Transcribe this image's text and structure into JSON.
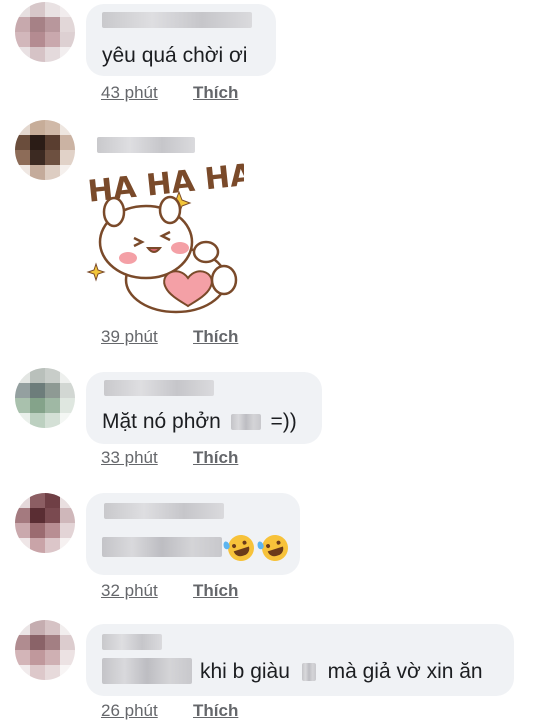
{
  "comments": [
    {
      "text": "yêu quá chời ơi",
      "time": "43 phút",
      "like": "Thích"
    },
    {
      "sticker_text": "HA HA HA",
      "time": "39 phút",
      "like": "Thích"
    },
    {
      "text_before": "Mặt nó phởn",
      "text_after": "=))",
      "time": "33 phút",
      "like": "Thích"
    },
    {
      "emoji": "rolling-on-floor-laughing",
      "time": "32 phút",
      "like": "Thích"
    },
    {
      "text_mid": "khi b giàu",
      "text_end": "mà giả vờ xin ăn",
      "time": "26 phút",
      "like": "Thích"
    }
  ],
  "colors": {
    "bubble": "#f0f2f5",
    "text": "#1c1e21",
    "meta": "#65676b",
    "sticker_brown": "#7a4a2a",
    "sticker_pink": "#f4a0a6"
  }
}
